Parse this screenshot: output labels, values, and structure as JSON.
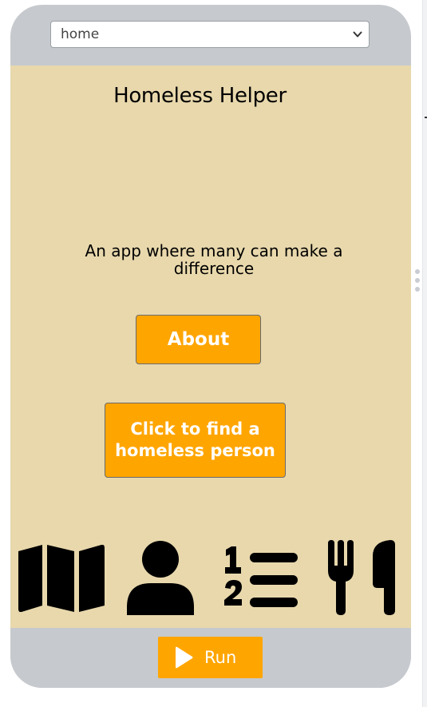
{
  "screen_select": {
    "value": "home"
  },
  "app": {
    "title": "Homeless Helper",
    "subtitle": "An app where many can make a difference",
    "about_button": "About",
    "find_button": "Click to find a homeless person",
    "background_color": "#e8d8ac",
    "button_color": "#ffa500"
  },
  "icons": [
    "map-icon",
    "user-icon",
    "numbered-list-icon",
    "utensils-icon"
  ],
  "run": {
    "label": "Run"
  }
}
